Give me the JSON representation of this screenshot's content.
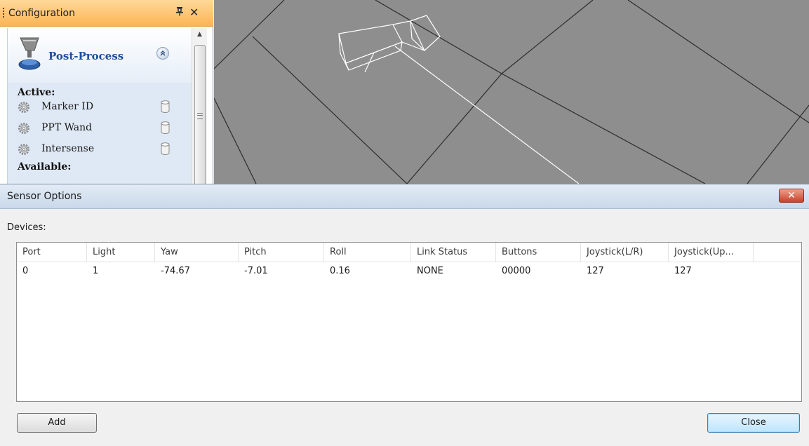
{
  "config_panel": {
    "title": "Configuration",
    "pin_glyph": "↑",
    "close_glyph": "✕",
    "section_title": "Post-Process",
    "collapse_glyph": "˄",
    "active_label": "Active:",
    "available_label": "Available:",
    "active_items": [
      {
        "name": "Marker ID",
        "icon": "gear-icon",
        "status_icon": "database-icon"
      },
      {
        "name": "PPT Wand",
        "icon": "gear-icon",
        "status_icon": "database-icon"
      },
      {
        "name": "Intersense",
        "icon": "gear-icon",
        "status_icon": "database-icon"
      }
    ]
  },
  "dialog": {
    "title": "Sensor Options",
    "close_glyph": "✕",
    "devices_label": "Devices:",
    "columns": [
      "Port",
      "Light",
      "Yaw",
      "Pitch",
      "Roll",
      "Link Status",
      "Buttons",
      "Joystick(L/R)",
      "Joystick(Up..."
    ],
    "rows": [
      [
        "0",
        "1",
        "-74.67",
        "-7.01",
        "0.16",
        "NONE",
        "00000",
        "127",
        "127"
      ]
    ],
    "add_label": "Add",
    "close_label": "Close"
  },
  "colors": {
    "header_orange": "#fbb553",
    "viewport_gray": "#8e8e8e",
    "section_blue": "#1e4f9a",
    "close_red": "#c9412a"
  }
}
